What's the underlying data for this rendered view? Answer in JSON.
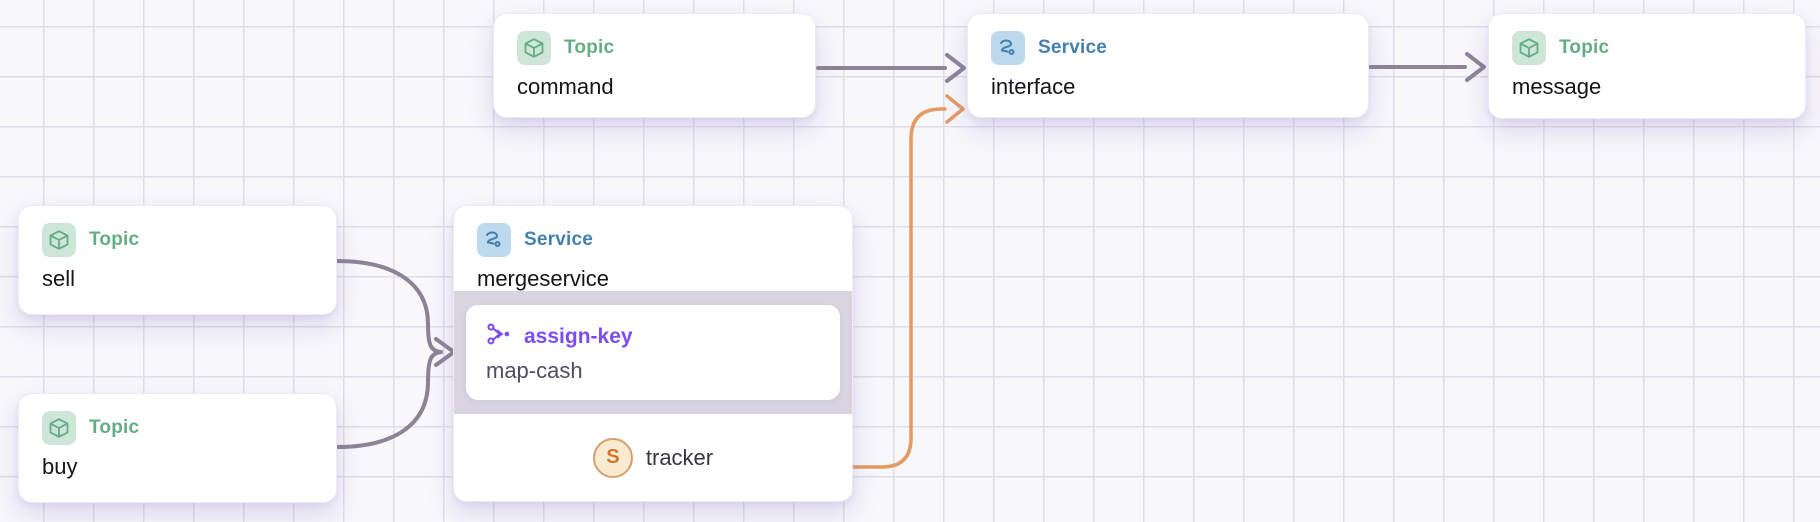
{
  "canvas": {
    "kind": "flow-topology-canvas",
    "grid": "on"
  },
  "nodes": {
    "command": {
      "type": "Topic",
      "name": "command"
    },
    "interface": {
      "type": "Service",
      "name": "interface"
    },
    "message": {
      "type": "Topic",
      "name": "message"
    },
    "sell": {
      "type": "Topic",
      "name": "sell"
    },
    "buy": {
      "type": "Topic",
      "name": "buy"
    },
    "mergeservice": {
      "type": "Service",
      "name": "mergeservice",
      "function": {
        "type": "assign-key",
        "name": "map-cash"
      },
      "sink": {
        "badge": "S",
        "name": "tracker"
      }
    }
  },
  "edges": [
    {
      "from": "command",
      "to": "interface",
      "color": "gray"
    },
    {
      "from": "interface",
      "to": "message",
      "color": "gray"
    },
    {
      "from": "sell",
      "to": "mergeservice",
      "color": "gray"
    },
    {
      "from": "buy",
      "to": "mergeservice",
      "color": "gray"
    },
    {
      "from": "mergeservice.tracker",
      "to": "interface",
      "color": "orange"
    }
  ],
  "colors": {
    "topic_accent": "#64ad85",
    "topic_icon_bg": "#cde6d8",
    "service_accent": "#4480ae",
    "service_icon_bg": "#bcd9ee",
    "function_accent": "#7b4df2",
    "sink_accent": "#d1762b",
    "sink_bg": "#faeacf",
    "sink_border": "#d6a06b",
    "edge_gray": "#8b8496",
    "edge_orange": "#e39a63",
    "band_bg": "#d8d5e1"
  }
}
